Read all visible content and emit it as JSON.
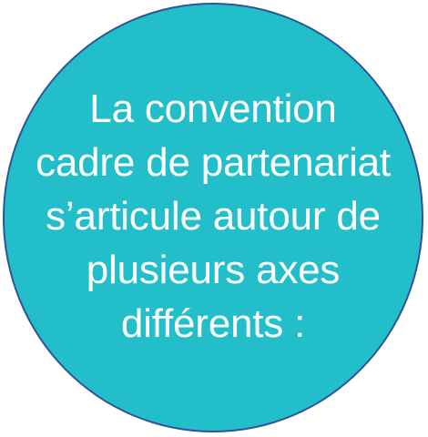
{
  "shape": {
    "fill_color": "#22bfca",
    "border_color": "#2f5597",
    "text_color": "#ffffff"
  },
  "text": {
    "lines": [
      "La convention",
      "cadre de partenariat",
      "s’articule autour de",
      "plusieurs axes",
      "différents :"
    ]
  }
}
